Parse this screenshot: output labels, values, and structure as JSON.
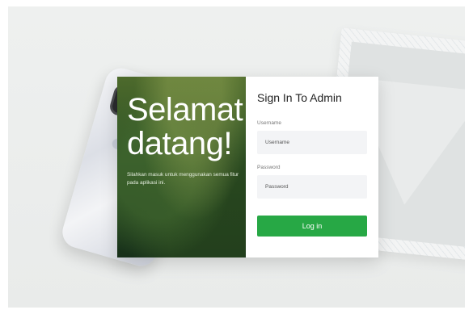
{
  "hero": {
    "title_line1": "Selamat",
    "title_line2": "datang!",
    "subtitle": "Silahkan masuk untuk menggunakan semua fitur pada aplikasi ini."
  },
  "form": {
    "title": "Sign In To Admin",
    "username_label": "Username",
    "username_placeholder": "Username",
    "password_label": "Password",
    "password_placeholder": "Password",
    "login_label": "Log in"
  },
  "colors": {
    "accent": "#27a845",
    "hero_dark": "#1f3d1c"
  },
  "icons": [
    "smartphone-image",
    "envelope-image"
  ]
}
